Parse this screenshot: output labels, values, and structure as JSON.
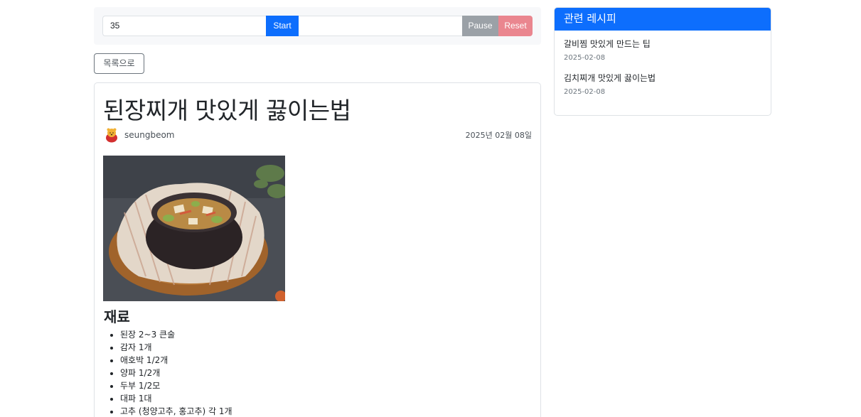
{
  "timer": {
    "value": "35",
    "start_label": "Start",
    "pause_label": "Pause",
    "reset_label": "Reset"
  },
  "nav": {
    "back_label": "목록으로"
  },
  "post": {
    "title": "된장찌개 맛있게 끓이는법",
    "author": "seungbeom",
    "date": "2025년 02월 08일",
    "section_heading": "재료",
    "ingredients": [
      "된장 2~3 큰술",
      "감자 1개",
      "애호박 1/2개",
      "양파 1/2개",
      "두부 1/2모",
      "대파 1대",
      "고추 (청양고추, 홍고추) 각 1개"
    ]
  },
  "sidebar": {
    "header": "관련 레시피",
    "items": [
      {
        "title": "갈비찜 맛있게 만드는 팁",
        "date": "2025-02-08"
      },
      {
        "title": "김치찌개 맛있게 끓이는법",
        "date": "2025-02-08"
      }
    ]
  },
  "colors": {
    "primary": "#0d6efd",
    "pause": "#9ba1a7",
    "reset": "#ea868f"
  }
}
